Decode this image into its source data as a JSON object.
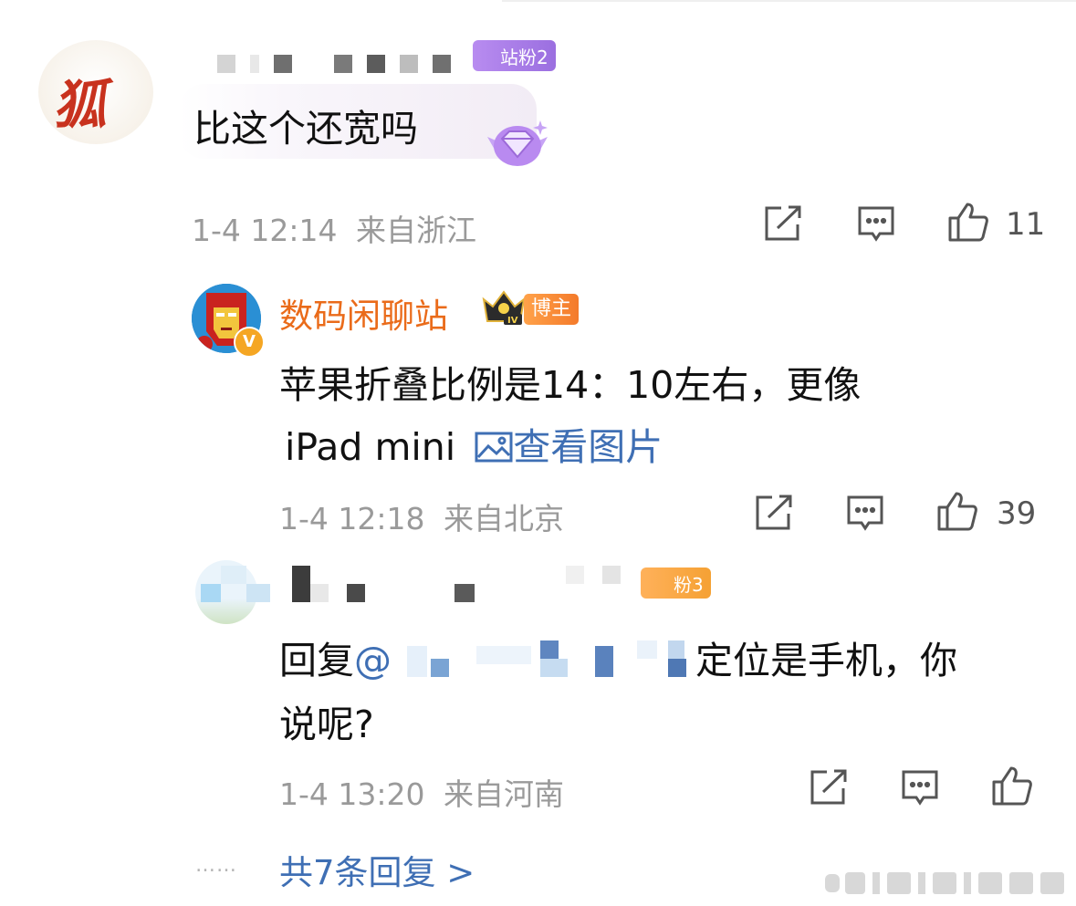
{
  "comments": [
    {
      "fan_badge": "站粉2",
      "text": "比这个还宽吗",
      "time": "1-4 12:14",
      "location": "来自浙江",
      "like_count": "11",
      "badge_color": "#a77fe0"
    },
    {
      "username": "数码闲聊站",
      "role_badge": "博主",
      "text_line1": "苹果折叠比例是14：10左右，更像",
      "text_line2": "iPad mini",
      "image_link": "查看图片",
      "time": "1-4 12:18",
      "location": "来自北京",
      "like_count": "39",
      "username_color": "#ea6b1a"
    },
    {
      "fan_badge": "粉3",
      "reply_prefix": "回复",
      "mention_at": "@",
      "text_after": "定位是手机，你",
      "text_line2": "说呢?",
      "time": "1-4 13:20",
      "location": "来自河南"
    }
  ],
  "more_replies": {
    "dots": "……",
    "label": "共7条回复 >"
  },
  "icons": {
    "share": "share-icon",
    "comment": "comment-icon",
    "like": "thumbs-up-icon"
  },
  "colors": {
    "link": "#3f6fb4",
    "meta_text": "#9a9a9a"
  }
}
